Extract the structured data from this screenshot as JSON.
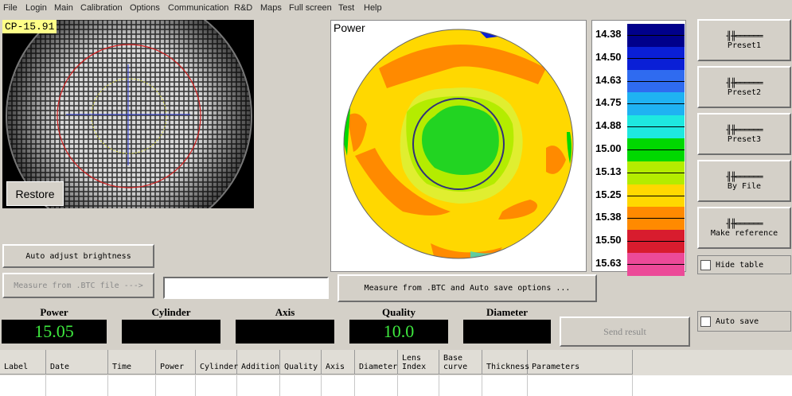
{
  "menu": [
    "File",
    "Login",
    "Main",
    "Calibration",
    "Options",
    "Communication",
    "R&D",
    "Maps",
    "Full screen",
    "Test",
    "Help"
  ],
  "camera": {
    "overlay_label": "CP-15.91",
    "restore_label": "Restore"
  },
  "power_map": {
    "title": "Power"
  },
  "scale": {
    "labels": [
      "14.38",
      "14.50",
      "14.63",
      "14.75",
      "14.88",
      "15.00",
      "15.13",
      "15.25",
      "15.38",
      "15.50",
      "15.63"
    ],
    "colors": [
      "#00008b",
      "#0a1fd6",
      "#2f6bf0",
      "#1fb2f2",
      "#1ee8e0",
      "#00d800",
      "#b4ec00",
      "#ffd800",
      "#ff8a00",
      "#d81c2e",
      "#ec4a98"
    ]
  },
  "presets": [
    "Preset1",
    "Preset2",
    "Preset3",
    "By File",
    "Make reference"
  ],
  "icon_glyph": "╢╫══════",
  "checkboxes": {
    "hide_table": "Hide table",
    "auto_save": "Auto save"
  },
  "buttons": {
    "auto_adjust": "Auto adjust brightness",
    "measure_btc": "Measure from .BTC file --->",
    "measure_btc_auto": "Measure from .BTC and Auto save options ...",
    "send_result": "Send result"
  },
  "file_input": {
    "value": ""
  },
  "results": {
    "power": {
      "label": "Power",
      "value": "15.05"
    },
    "cylinder": {
      "label": "Cylinder",
      "value": ""
    },
    "axis": {
      "label": "Axis",
      "value": ""
    },
    "quality": {
      "label": "Quality",
      "value": "10.0"
    },
    "diameter": {
      "label": "Diameter",
      "value": ""
    }
  },
  "table": {
    "columns": [
      "Label",
      "Date",
      "Time",
      "Power",
      "Cylinder",
      "Addition",
      "Quality",
      "Axis",
      "Diameter",
      "Lens Index",
      "Base curve",
      "Thickness",
      "Parameters"
    ]
  }
}
